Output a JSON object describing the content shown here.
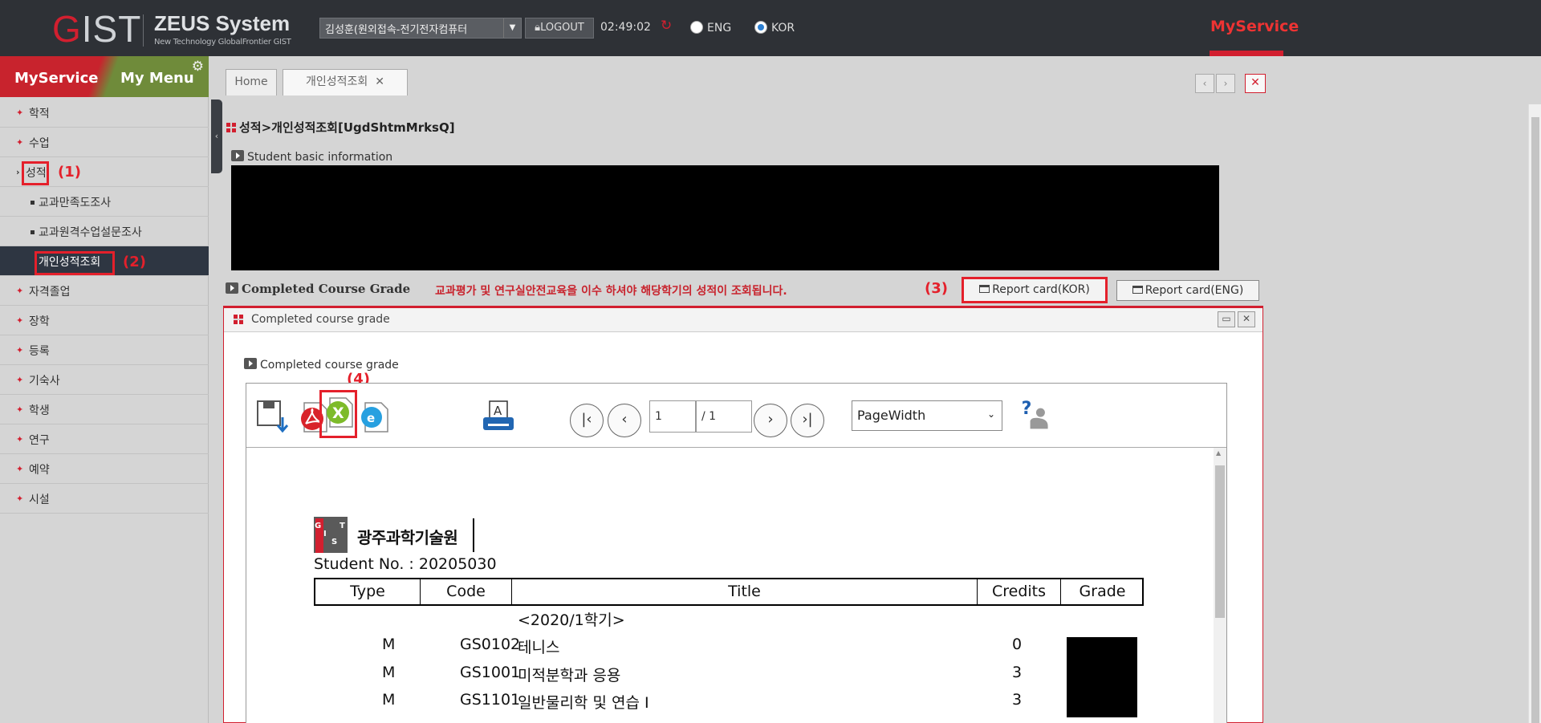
{
  "header": {
    "logo": "GIST",
    "system_title": "ZEUS System",
    "system_subtitle": "New Technology GlobalFrontier GIST",
    "user": "김성훈(원외접속-전기전자컴퓨터",
    "logout_label": "LOGOUT",
    "clock": "02:49:02",
    "lang_eng": "ENG",
    "lang_kor": "KOR",
    "selected_lang": "KOR",
    "myservice": "MyService"
  },
  "sidebar": {
    "tab_myservice": "MyService",
    "tab_mymenu": "My Menu",
    "items": [
      {
        "label": "학적"
      },
      {
        "label": "수업"
      },
      {
        "label": "성적"
      },
      {
        "label": "교과만족도조사"
      },
      {
        "label": "교과원격수업설문조사"
      },
      {
        "label": "개인성적조회"
      },
      {
        "label": "자격졸업"
      },
      {
        "label": "장학"
      },
      {
        "label": "등록"
      },
      {
        "label": "기숙사"
      },
      {
        "label": "학생"
      },
      {
        "label": "연구"
      },
      {
        "label": "예약"
      },
      {
        "label": "시설"
      }
    ]
  },
  "annotations": [
    "(1)",
    "(2)",
    "(3)",
    "(4)"
  ],
  "tabs": {
    "home": "Home",
    "current": "개인성적조회",
    "close_mark": "✕"
  },
  "main": {
    "title": "성적>개인성적조회[UgdShtmMrksQ]",
    "basic_info": "Student basic information",
    "completed_grade": "Completed Course Grade",
    "notice": "교과평가 및 연구실안전교육을 이수 하셔야 해당학기의 성적이 조회됩니다.",
    "report_kor": "Report card(KOR)",
    "report_eng": "Report card(ENG)"
  },
  "popup": {
    "title": "Completed course grade",
    "section": "Completed course grade",
    "page_current": "1",
    "page_total": "/ 1",
    "zoom": "PageWidth"
  },
  "report": {
    "institution": "광주과학기술원",
    "logo_letters": [
      "G",
      "I",
      "S",
      "T"
    ],
    "student_no": "Student No. : 20205030",
    "columns": [
      "Type",
      "Code",
      "Title",
      "Credits",
      "Grade"
    ],
    "semester": "<2020/1학기>",
    "rows": [
      {
        "type": "M",
        "code": "GS0102",
        "title": "테니스",
        "credits": "0"
      },
      {
        "type": "M",
        "code": "GS1001",
        "title": "미적분학과 응용",
        "credits": "3"
      },
      {
        "type": "M",
        "code": "GS1101",
        "title": "일반물리학 및 연습 I",
        "credits": "3"
      }
    ]
  },
  "colors": {
    "accent_red": "#d21f2f",
    "header_bg": "#2e3136",
    "active_menu_bg": "#2e3642"
  }
}
